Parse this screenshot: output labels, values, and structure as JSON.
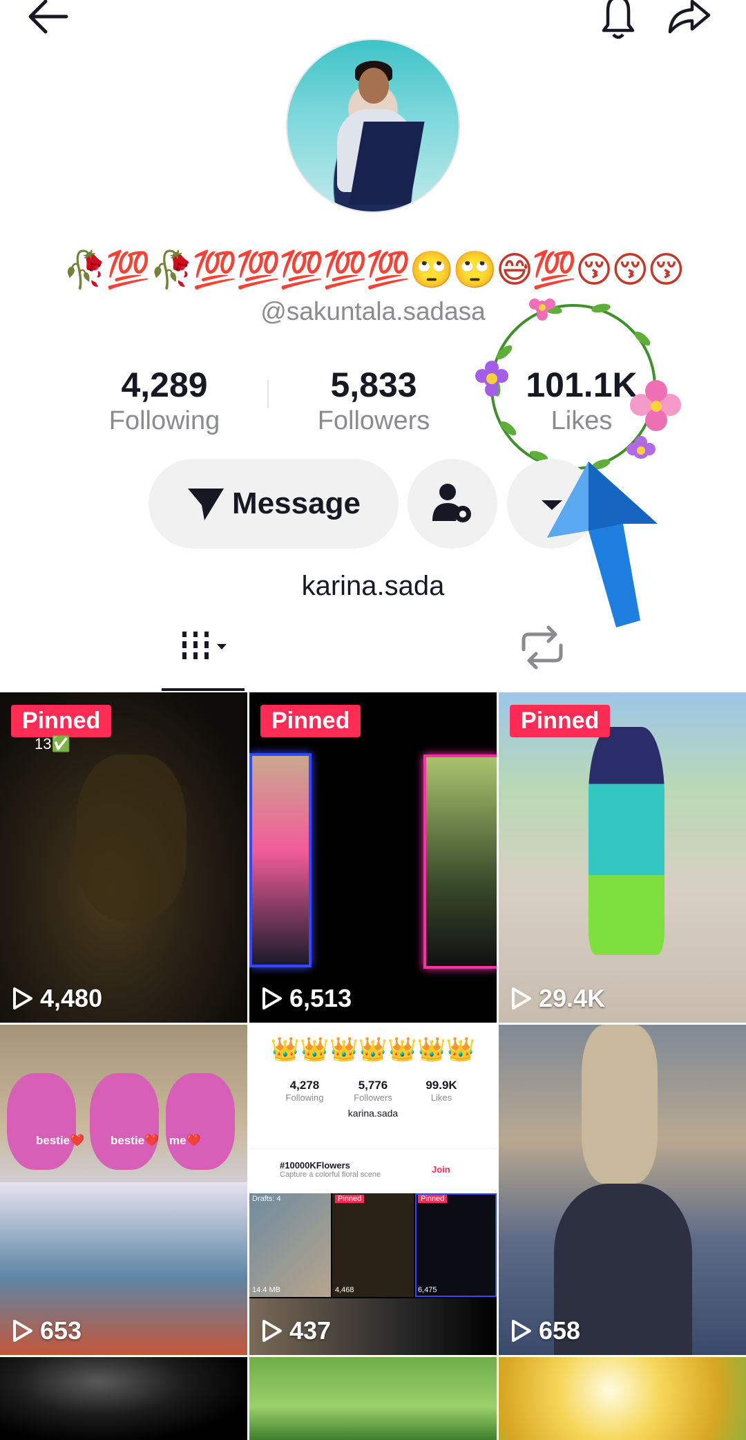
{
  "header": {
    "back_icon": "back-arrow-icon",
    "bell_icon": "bell-icon",
    "share_icon": "share-icon"
  },
  "profile": {
    "nickname": "🥀💯🥀💯💯💯💯💯🙄🙄😅💯😚😚😚",
    "handle": "@sakuntala.sadasa",
    "bio": "karina.sada"
  },
  "stats": {
    "following": {
      "value": "4,289",
      "label": "Following"
    },
    "followers": {
      "value": "5,833",
      "label": "Followers"
    },
    "likes": {
      "value": "101.1K",
      "label": "Likes"
    }
  },
  "actions": {
    "message_label": "Message",
    "message_icon": "paper-plane-icon",
    "friends_icon": "user-settings-icon",
    "more_icon": "chevron-down-icon"
  },
  "tabs": {
    "videos_icon": "grid-icon",
    "reposts_icon": "repost-icon"
  },
  "videos": [
    {
      "pinned": "Pinned",
      "views": "4,480",
      "overlay": "13✅"
    },
    {
      "pinned": "Pinned",
      "views": "6,513"
    },
    {
      "pinned": "Pinned",
      "views": "29.4K"
    },
    {
      "views": "653",
      "captions": [
        "bestie❤️",
        "bestie❤️",
        "me❤️"
      ]
    },
    {
      "views": "437"
    },
    {
      "views": "658"
    }
  ],
  "mini_profile": {
    "crowns": "👑👑👑👑👑👑👑",
    "following": "4,278",
    "following_label": "Following",
    "followers": "5,776",
    "followers_label": "Followers",
    "likes": "99.9K",
    "likes_label": "Likes",
    "name": "karina.sada",
    "hashtag": "#10000KFlowers",
    "hashtag_sub": "Capture a colorful floral scene",
    "join": "Join",
    "drafts": "Drafts: 4",
    "size": "14.4 MB",
    "pinned": "Pinned",
    "v1": "4,468",
    "v2": "6,475"
  },
  "colors": {
    "accent": "#fe2c55",
    "text": "#161823",
    "muted": "#8a8b91",
    "button_bg": "#f1f1f2"
  }
}
